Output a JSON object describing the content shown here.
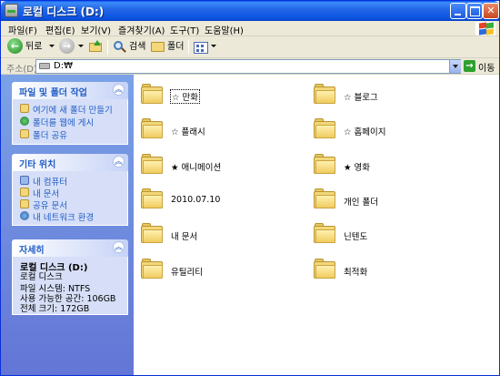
{
  "window": {
    "title": "로컬 디스크 (D:)"
  },
  "menu": [
    "파일(F)",
    "편집(E)",
    "보기(V)",
    "즐겨찾기(A)",
    "도구(T)",
    "도움말(H)"
  ],
  "toolbar": {
    "back_label": "뒤로",
    "search_label": "검색",
    "folders_label": "폴더"
  },
  "address": {
    "label": "주소(D)",
    "path": "D:₩",
    "go_label": "이동"
  },
  "tasks": {
    "file_folder": {
      "title": "파일 및 폴더 작업",
      "items": [
        "여기에 새 폴더 만들기",
        "폴더를 웹에 게시",
        "폴더 공유"
      ]
    },
    "other_places": {
      "title": "기타 위치",
      "items": [
        "내 컴퓨터",
        "내 문서",
        "공유 문서",
        "내 네트워크 환경"
      ]
    },
    "details": {
      "title": "자세히",
      "name": "로컬 디스크 (D:)",
      "type": "로컬 디스크",
      "filesystem": "파일 시스템: NTFS",
      "free": "사용 가능한 공간: 106GB",
      "total": "전체 크기: 172GB"
    }
  },
  "folders": [
    "☆ 만화",
    "☆ 블로그",
    "☆ 플래시",
    "☆ 홈페이지",
    "★ 애니메이션",
    "★ 영화",
    "2010.07.10",
    "개인 폴더",
    "내 문서",
    "닌텐도",
    "유틸리티",
    "최적화"
  ],
  "colors": {
    "titlebar": "#0a52e0",
    "taskpane": "#6375d6",
    "link": "#215dc6",
    "folder": "#f3d77a"
  }
}
